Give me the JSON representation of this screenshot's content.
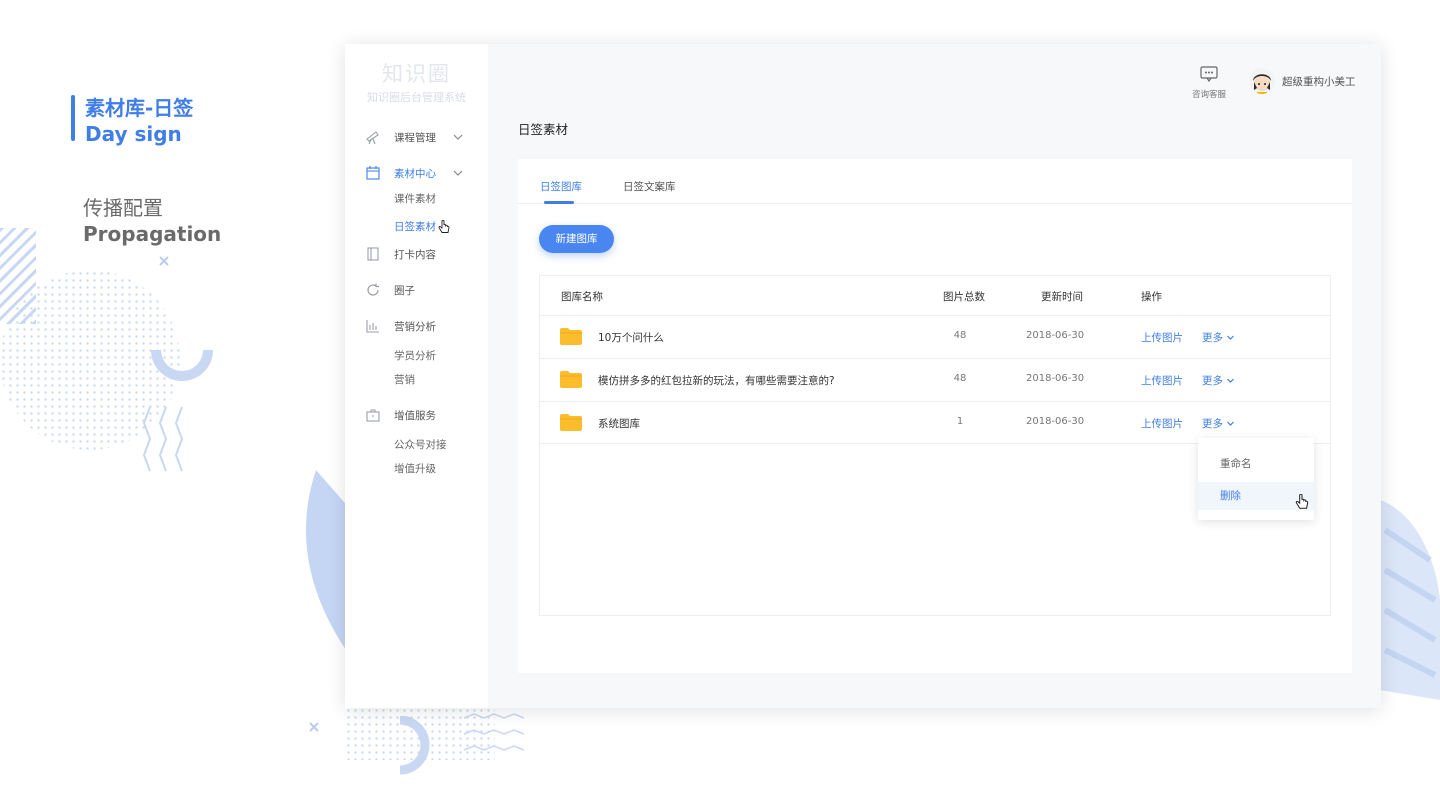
{
  "caption": {
    "title_cn": "素材库-日签",
    "title_en": "Day sign",
    "sub_cn": "传播配置",
    "sub_en": "Propagation"
  },
  "app": {
    "brand": "知识圈",
    "brand_sub": "知识圈后台管理系统"
  },
  "sidebar": {
    "items": [
      {
        "label": "课程管理",
        "icon": "telescope-icon"
      },
      {
        "label": "素材中心",
        "icon": "calendar-icon"
      },
      {
        "label": "打卡内容",
        "icon": "notebook-icon"
      },
      {
        "label": "圈子",
        "icon": "refresh-icon"
      },
      {
        "label": "营销分析",
        "icon": "bar-chart-icon"
      },
      {
        "label": "增值服务",
        "icon": "briefcase-icon"
      }
    ],
    "sub_material": [
      "课件素材",
      "日签素材"
    ],
    "sub_marketing": [
      "学员分析",
      "营销"
    ],
    "sub_value": [
      "公众号对接",
      "增值升级"
    ]
  },
  "header": {
    "service_label": "咨询客服",
    "username": "超级重构小美工"
  },
  "page": {
    "title": "日签素材",
    "tabs": [
      "日签图库",
      "日签文案库"
    ],
    "new_button": "新建图库"
  },
  "table": {
    "headers": [
      "图库名称",
      "图片总数",
      "更新时间",
      "操作"
    ],
    "rows": [
      {
        "name": "10万个问什么",
        "count": "48",
        "date": "2018-06-30",
        "upload": "上传图片",
        "more": "更多"
      },
      {
        "name": "模仿拼多多的红包拉新的玩法，有哪些需要注意的?",
        "count": "48",
        "date": "2018-06-30",
        "upload": "上传图片",
        "more": "更多"
      },
      {
        "name": "系统图库",
        "count": "1",
        "date": "2018-06-30",
        "upload": "上传图片",
        "more": "更多"
      }
    ]
  },
  "dropdown": {
    "items": [
      "重命名",
      "删除"
    ]
  },
  "colors": {
    "accent": "#3f7ee8",
    "folder": "#fbbd2c"
  }
}
